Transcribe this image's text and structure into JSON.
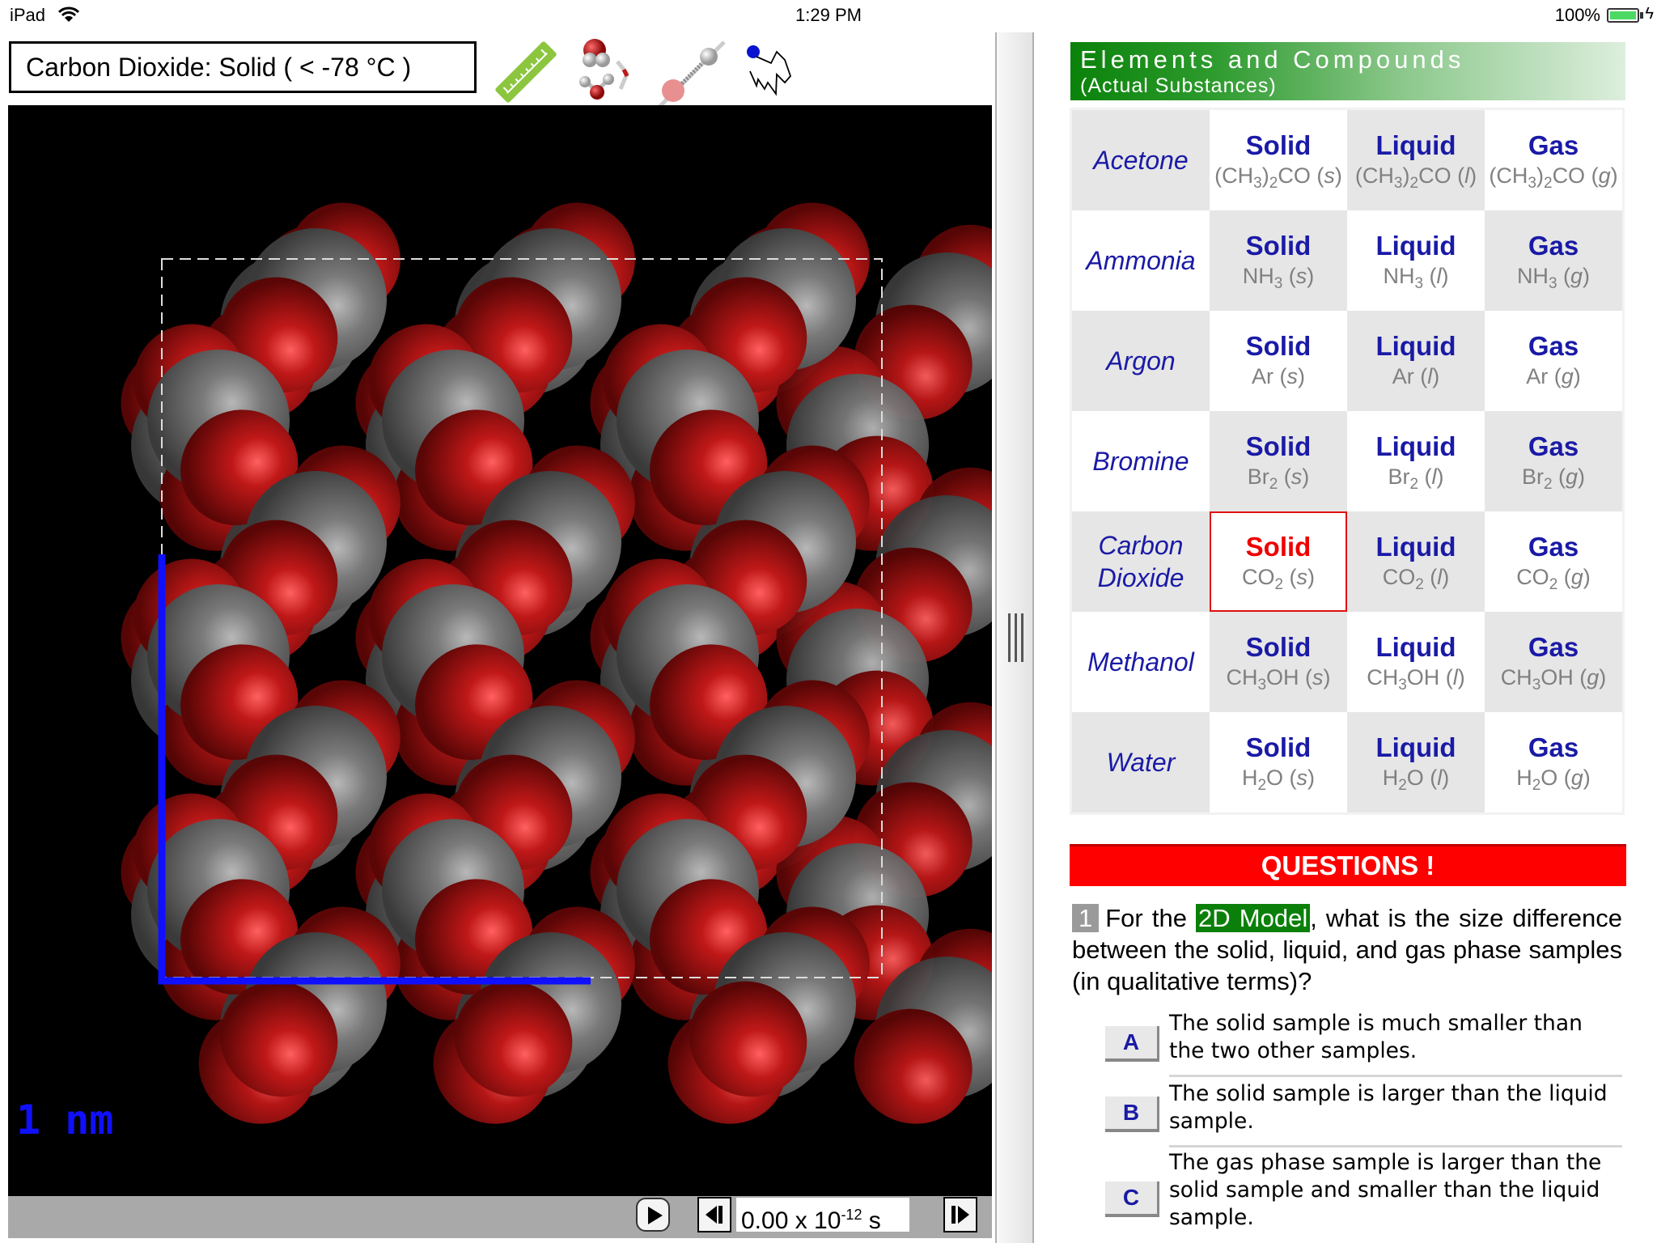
{
  "status_bar": {
    "device": "iPad",
    "time": "1:29 PM",
    "battery": "100%",
    "icons": [
      "wifi-icon",
      "battery-icon",
      "charging-bolt-icon"
    ]
  },
  "simulation": {
    "title": "Carbon Dioxide: Solid ( < -78 °C )",
    "tools": [
      {
        "name": "ruler-tool",
        "icon": "ruler-icon"
      },
      {
        "name": "hydrogen-bond-tool",
        "icon": "hydrogen-bond-icon"
      },
      {
        "name": "bond-tool",
        "icon": "ball-stick-icon"
      },
      {
        "name": "random-walk-tool",
        "icon": "random-walk-icon"
      }
    ],
    "scale_label": "1 nm",
    "atom_colors": {
      "carbon": "#6b6b6b",
      "oxygen": "#c01818",
      "scale_bar": "#1010ff"
    },
    "time": {
      "prefix": "0.00 x 10",
      "exponent": "-12",
      "unit": " s"
    },
    "controls": {
      "play": "play",
      "step_back": "step-back",
      "step_forward": "step-forward"
    }
  },
  "panel": {
    "title": "Elements and Compounds",
    "subtitle": "(Actual Substances)",
    "phase_labels": [
      "Solid",
      "Liquid",
      "Gas"
    ],
    "selected": {
      "substance": "Carbon Dioxide",
      "phase": "Solid"
    },
    "rows": [
      {
        "name": "Acetone",
        "formula": [
          [
            "(CH",
            "3",
            ")",
            "2",
            "CO "
          ]
        ],
        "f": "(CH3)2CO"
      },
      {
        "name": "Ammonia",
        "f": "NH3"
      },
      {
        "name": "Argon",
        "f": "Ar"
      },
      {
        "name": "Bromine",
        "f": "Br2"
      },
      {
        "name": "Carbon Dioxide",
        "f": "CO2"
      },
      {
        "name": "Methanol",
        "f": "CH3OH"
      },
      {
        "name": "Water",
        "f": "H2O"
      }
    ],
    "phase_suffix": [
      "s",
      "l",
      "g"
    ]
  },
  "questions": {
    "header": "QUESTIONS !",
    "number": "1",
    "text_before": "For the ",
    "highlight": "2D Model",
    "text_after": ", what is the size difference between the solid, liquid, and gas phase samples (in qualitative terms)?",
    "answers": [
      {
        "letter": "A",
        "text": "The solid sample is much smaller than the two other samples."
      },
      {
        "letter": "B",
        "text": "The solid sample is larger than the liquid sample."
      },
      {
        "letter": "C",
        "text": "The gas phase sample is larger than the solid sample and smaller than the liquid sample."
      }
    ]
  }
}
